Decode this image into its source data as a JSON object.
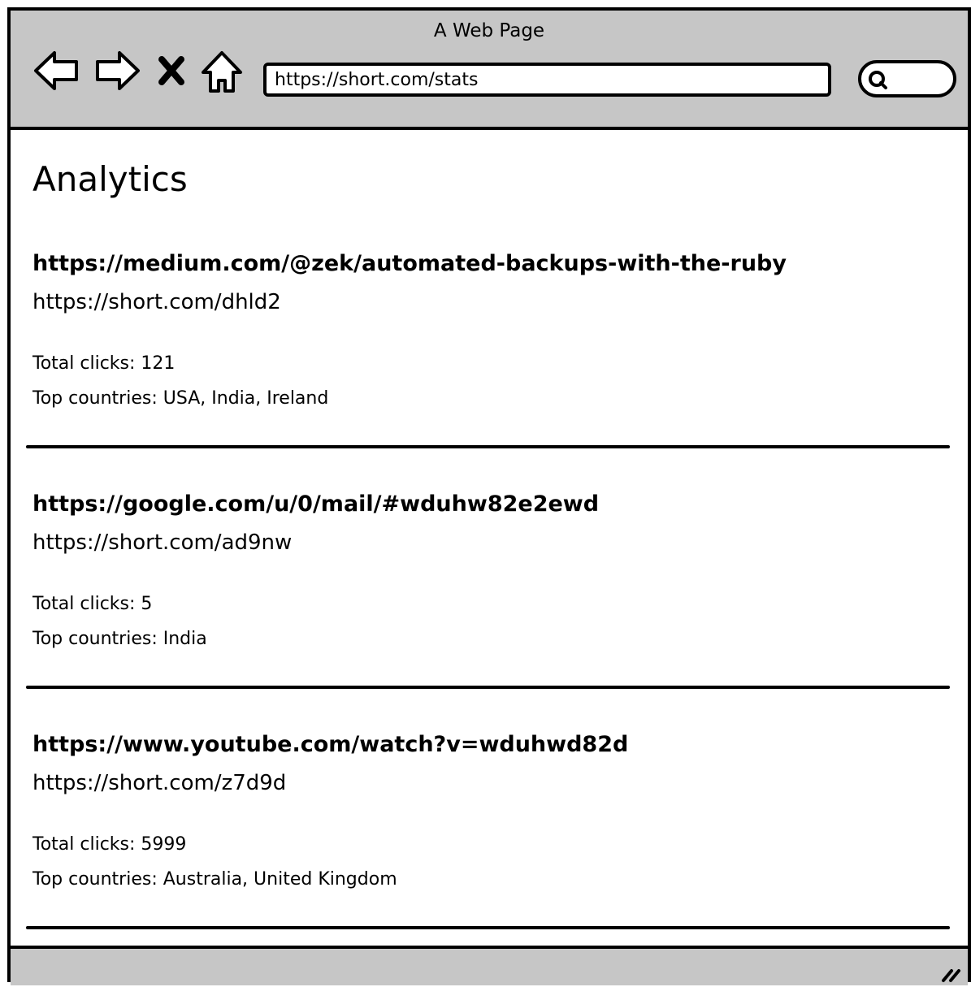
{
  "window": {
    "title": "A Web Page",
    "url": "https://short.com/stats"
  },
  "icons": {
    "back": "back-arrow-icon",
    "forward": "forward-arrow-icon",
    "stop": "close-icon",
    "home": "home-icon",
    "search": "search-icon",
    "resize": "resize-grip-icon"
  },
  "page": {
    "title": "Analytics"
  },
  "links": [
    {
      "long_url": "https://medium.com/@zek/automated-backups-with-the-ruby",
      "short_url": "https://short.com/dhld2",
      "clicks": "Total clicks: 121",
      "countries": "Top countries: USA, India, Ireland"
    },
    {
      "long_url": "https://google.com/u/0/mail/#wduhw82e2ewd",
      "short_url": "https://short.com/ad9nw",
      "clicks": "Total clicks: 5",
      "countries": "Top countries: India"
    },
    {
      "long_url": "https://www.youtube.com/watch?v=wduhwd82d",
      "short_url": "https://short.com/z7d9d",
      "clicks": "Total clicks: 5999",
      "countries": "Top countries: Australia, United Kingdom"
    }
  ],
  "colors": {
    "chrome": "#c6c6c6",
    "ink": "#000000",
    "background": "#ffffff"
  }
}
